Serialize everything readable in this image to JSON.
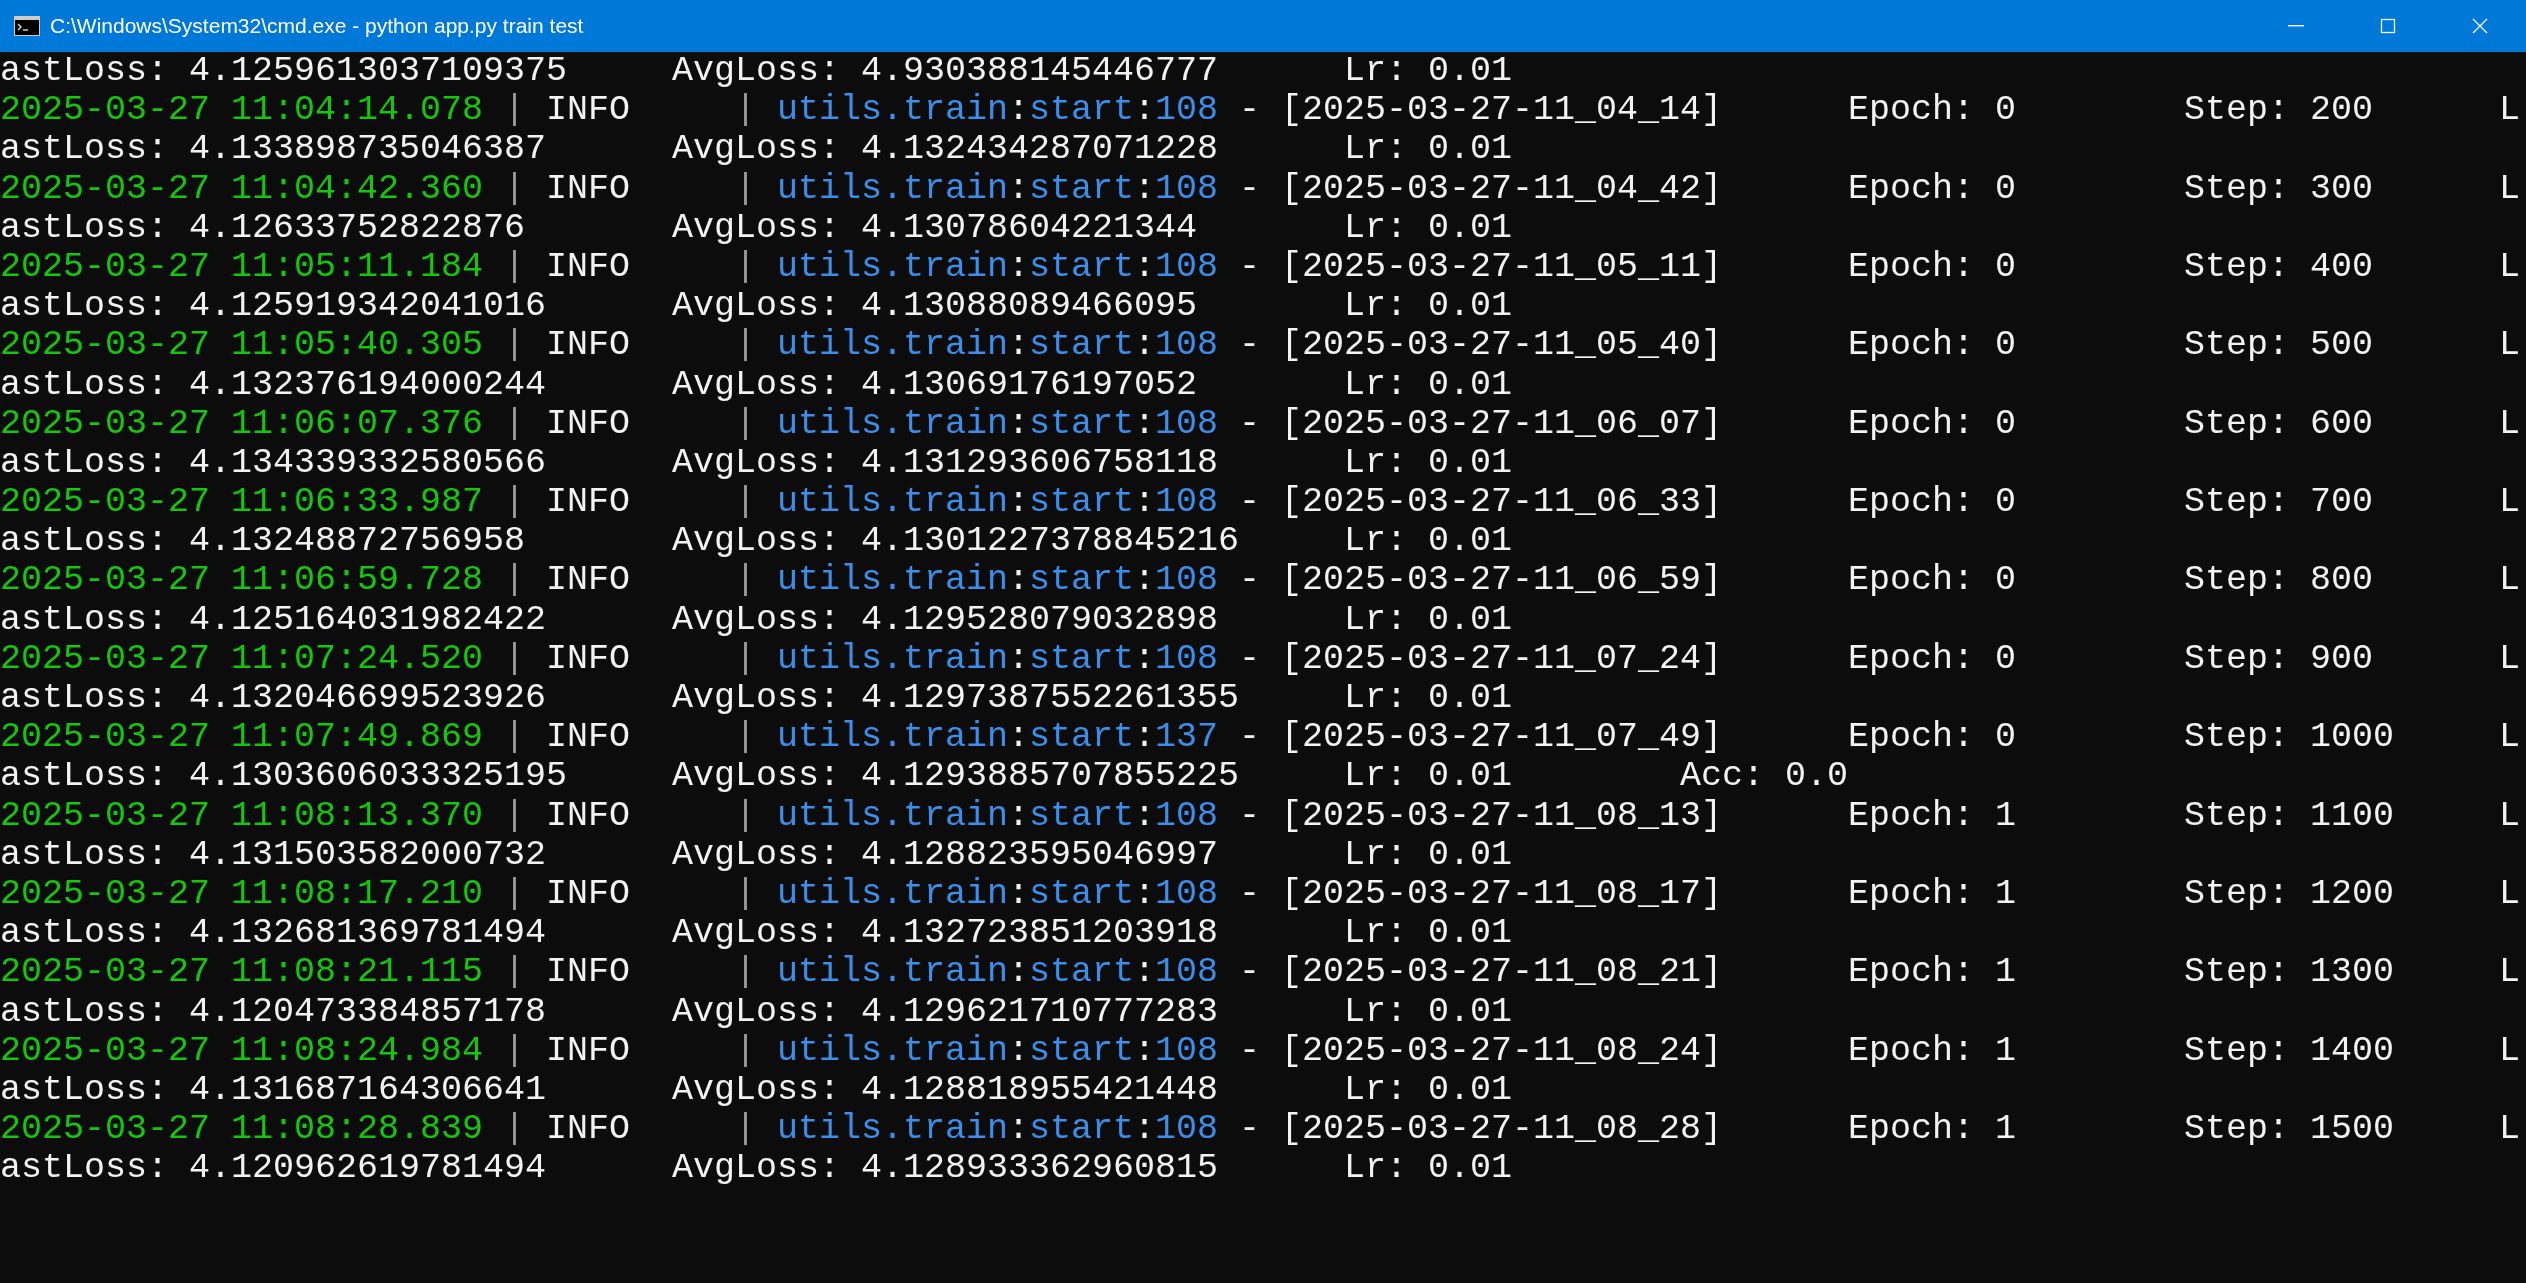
{
  "window": {
    "title": "C:\\Windows\\System32\\cmd.exe - python  app.py train test"
  },
  "lines": [
    {
      "kind": "loss",
      "segments": [
        {
          "kind": "value",
          "text": "astLoss: 4.1259613037109375"
        },
        {
          "kind": "value",
          "text": "AvgLoss: 4.930388145446777"
        },
        {
          "kind": "value",
          "text": "Lr: 0.01"
        }
      ]
    },
    {
      "kind": "log",
      "segments": [
        {
          "kind": "timestamp",
          "text": "2025-03-27 11:04:14.078"
        },
        {
          "kind": "bar",
          "text": "|"
        },
        {
          "kind": "level",
          "text": "INFO"
        },
        {
          "kind": "bar",
          "text": "|"
        },
        {
          "kind": "module",
          "text": "utils.train"
        },
        {
          "kind": "colon",
          "text": ":"
        },
        {
          "kind": "function",
          "text": "start"
        },
        {
          "kind": "colon",
          "text": ":"
        },
        {
          "kind": "lineno",
          "text": "108"
        },
        {
          "kind": "dash",
          "text": "-"
        },
        {
          "kind": "value",
          "text": "[2025-03-27-11_04_14]"
        },
        {
          "kind": "value",
          "text": "Epoch: 0"
        },
        {
          "kind": "value",
          "text": "Step: 200"
        },
        {
          "kind": "value",
          "text": "L"
        }
      ]
    },
    {
      "kind": "loss",
      "segments": [
        {
          "kind": "value",
          "text": "astLoss: 4.133898735046387"
        },
        {
          "kind": "value",
          "text": "AvgLoss: 4.132434287071228"
        },
        {
          "kind": "value",
          "text": "Lr: 0.01"
        }
      ]
    },
    {
      "kind": "log",
      "segments": [
        {
          "kind": "timestamp",
          "text": "2025-03-27 11:04:42.360"
        },
        {
          "kind": "bar",
          "text": "|"
        },
        {
          "kind": "level",
          "text": "INFO"
        },
        {
          "kind": "bar",
          "text": "|"
        },
        {
          "kind": "module",
          "text": "utils.train"
        },
        {
          "kind": "colon",
          "text": ":"
        },
        {
          "kind": "function",
          "text": "start"
        },
        {
          "kind": "colon",
          "text": ":"
        },
        {
          "kind": "lineno",
          "text": "108"
        },
        {
          "kind": "dash",
          "text": "-"
        },
        {
          "kind": "value",
          "text": "[2025-03-27-11_04_42]"
        },
        {
          "kind": "value",
          "text": "Epoch: 0"
        },
        {
          "kind": "value",
          "text": "Step: 300"
        },
        {
          "kind": "value",
          "text": "L"
        }
      ]
    },
    {
      "kind": "loss",
      "segments": [
        {
          "kind": "value",
          "text": "astLoss: 4.12633752822876"
        },
        {
          "kind": "value",
          "text": "AvgLoss: 4.13078604221344"
        },
        {
          "kind": "value",
          "text": "Lr: 0.01"
        }
      ]
    },
    {
      "kind": "log",
      "segments": [
        {
          "kind": "timestamp",
          "text": "2025-03-27 11:05:11.184"
        },
        {
          "kind": "bar",
          "text": "|"
        },
        {
          "kind": "level",
          "text": "INFO"
        },
        {
          "kind": "bar",
          "text": "|"
        },
        {
          "kind": "module",
          "text": "utils.train"
        },
        {
          "kind": "colon",
          "text": ":"
        },
        {
          "kind": "function",
          "text": "start"
        },
        {
          "kind": "colon",
          "text": ":"
        },
        {
          "kind": "lineno",
          "text": "108"
        },
        {
          "kind": "dash",
          "text": "-"
        },
        {
          "kind": "value",
          "text": "[2025-03-27-11_05_11]"
        },
        {
          "kind": "value",
          "text": "Epoch: 0"
        },
        {
          "kind": "value",
          "text": "Step: 400"
        },
        {
          "kind": "value",
          "text": "L"
        }
      ]
    },
    {
      "kind": "loss",
      "segments": [
        {
          "kind": "value",
          "text": "astLoss: 4.125919342041016"
        },
        {
          "kind": "value",
          "text": "AvgLoss: 4.13088089466095"
        },
        {
          "kind": "value",
          "text": "Lr: 0.01"
        }
      ]
    },
    {
      "kind": "log",
      "segments": [
        {
          "kind": "timestamp",
          "text": "2025-03-27 11:05:40.305"
        },
        {
          "kind": "bar",
          "text": "|"
        },
        {
          "kind": "level",
          "text": "INFO"
        },
        {
          "kind": "bar",
          "text": "|"
        },
        {
          "kind": "module",
          "text": "utils.train"
        },
        {
          "kind": "colon",
          "text": ":"
        },
        {
          "kind": "function",
          "text": "start"
        },
        {
          "kind": "colon",
          "text": ":"
        },
        {
          "kind": "lineno",
          "text": "108"
        },
        {
          "kind": "dash",
          "text": "-"
        },
        {
          "kind": "value",
          "text": "[2025-03-27-11_05_40]"
        },
        {
          "kind": "value",
          "text": "Epoch: 0"
        },
        {
          "kind": "value",
          "text": "Step: 500"
        },
        {
          "kind": "value",
          "text": "L"
        }
      ]
    },
    {
      "kind": "loss",
      "segments": [
        {
          "kind": "value",
          "text": "astLoss: 4.132376194000244"
        },
        {
          "kind": "value",
          "text": "AvgLoss: 4.13069176197052"
        },
        {
          "kind": "value",
          "text": "Lr: 0.01"
        }
      ]
    },
    {
      "kind": "log",
      "segments": [
        {
          "kind": "timestamp",
          "text": "2025-03-27 11:06:07.376"
        },
        {
          "kind": "bar",
          "text": "|"
        },
        {
          "kind": "level",
          "text": "INFO"
        },
        {
          "kind": "bar",
          "text": "|"
        },
        {
          "kind": "module",
          "text": "utils.train"
        },
        {
          "kind": "colon",
          "text": ":"
        },
        {
          "kind": "function",
          "text": "start"
        },
        {
          "kind": "colon",
          "text": ":"
        },
        {
          "kind": "lineno",
          "text": "108"
        },
        {
          "kind": "dash",
          "text": "-"
        },
        {
          "kind": "value",
          "text": "[2025-03-27-11_06_07]"
        },
        {
          "kind": "value",
          "text": "Epoch: 0"
        },
        {
          "kind": "value",
          "text": "Step: 600"
        },
        {
          "kind": "value",
          "text": "L"
        }
      ]
    },
    {
      "kind": "loss",
      "segments": [
        {
          "kind": "value",
          "text": "astLoss: 4.134339332580566"
        },
        {
          "kind": "value",
          "text": "AvgLoss: 4.131293606758118"
        },
        {
          "kind": "value",
          "text": "Lr: 0.01"
        }
      ]
    },
    {
      "kind": "log",
      "segments": [
        {
          "kind": "timestamp",
          "text": "2025-03-27 11:06:33.987"
        },
        {
          "kind": "bar",
          "text": "|"
        },
        {
          "kind": "level",
          "text": "INFO"
        },
        {
          "kind": "bar",
          "text": "|"
        },
        {
          "kind": "module",
          "text": "utils.train"
        },
        {
          "kind": "colon",
          "text": ":"
        },
        {
          "kind": "function",
          "text": "start"
        },
        {
          "kind": "colon",
          "text": ":"
        },
        {
          "kind": "lineno",
          "text": "108"
        },
        {
          "kind": "dash",
          "text": "-"
        },
        {
          "kind": "value",
          "text": "[2025-03-27-11_06_33]"
        },
        {
          "kind": "value",
          "text": "Epoch: 0"
        },
        {
          "kind": "value",
          "text": "Step: 700"
        },
        {
          "kind": "value",
          "text": "L"
        }
      ]
    },
    {
      "kind": "loss",
      "segments": [
        {
          "kind": "value",
          "text": "astLoss: 4.13248872756958"
        },
        {
          "kind": "value",
          "text": "AvgLoss: 4.1301227378845216"
        },
        {
          "kind": "value",
          "text": "Lr: 0.01"
        }
      ]
    },
    {
      "kind": "log",
      "segments": [
        {
          "kind": "timestamp",
          "text": "2025-03-27 11:06:59.728"
        },
        {
          "kind": "bar",
          "text": "|"
        },
        {
          "kind": "level",
          "text": "INFO"
        },
        {
          "kind": "bar",
          "text": "|"
        },
        {
          "kind": "module",
          "text": "utils.train"
        },
        {
          "kind": "colon",
          "text": ":"
        },
        {
          "kind": "function",
          "text": "start"
        },
        {
          "kind": "colon",
          "text": ":"
        },
        {
          "kind": "lineno",
          "text": "108"
        },
        {
          "kind": "dash",
          "text": "-"
        },
        {
          "kind": "value",
          "text": "[2025-03-27-11_06_59]"
        },
        {
          "kind": "value",
          "text": "Epoch: 0"
        },
        {
          "kind": "value",
          "text": "Step: 800"
        },
        {
          "kind": "value",
          "text": "L"
        }
      ]
    },
    {
      "kind": "loss",
      "segments": [
        {
          "kind": "value",
          "text": "astLoss: 4.125164031982422"
        },
        {
          "kind": "value",
          "text": "AvgLoss: 4.129528079032898"
        },
        {
          "kind": "value",
          "text": "Lr: 0.01"
        }
      ]
    },
    {
      "kind": "log",
      "segments": [
        {
          "kind": "timestamp",
          "text": "2025-03-27 11:07:24.520"
        },
        {
          "kind": "bar",
          "text": "|"
        },
        {
          "kind": "level",
          "text": "INFO"
        },
        {
          "kind": "bar",
          "text": "|"
        },
        {
          "kind": "module",
          "text": "utils.train"
        },
        {
          "kind": "colon",
          "text": ":"
        },
        {
          "kind": "function",
          "text": "start"
        },
        {
          "kind": "colon",
          "text": ":"
        },
        {
          "kind": "lineno",
          "text": "108"
        },
        {
          "kind": "dash",
          "text": "-"
        },
        {
          "kind": "value",
          "text": "[2025-03-27-11_07_24]"
        },
        {
          "kind": "value",
          "text": "Epoch: 0"
        },
        {
          "kind": "value",
          "text": "Step: 900"
        },
        {
          "kind": "value",
          "text": "L"
        }
      ]
    },
    {
      "kind": "loss",
      "segments": [
        {
          "kind": "value",
          "text": "astLoss: 4.132046699523926"
        },
        {
          "kind": "value",
          "text": "AvgLoss: 4.1297387552261355"
        },
        {
          "kind": "value",
          "text": "Lr: 0.01"
        }
      ]
    },
    {
      "kind": "log",
      "segments": [
        {
          "kind": "timestamp",
          "text": "2025-03-27 11:07:49.869"
        },
        {
          "kind": "bar",
          "text": "|"
        },
        {
          "kind": "level",
          "text": "INFO"
        },
        {
          "kind": "bar",
          "text": "|"
        },
        {
          "kind": "module",
          "text": "utils.train"
        },
        {
          "kind": "colon",
          "text": ":"
        },
        {
          "kind": "function",
          "text": "start"
        },
        {
          "kind": "colon",
          "text": ":"
        },
        {
          "kind": "lineno",
          "text": "137"
        },
        {
          "kind": "dash",
          "text": "-"
        },
        {
          "kind": "value",
          "text": "[2025-03-27-11_07_49]"
        },
        {
          "kind": "value",
          "text": "Epoch: 0"
        },
        {
          "kind": "value",
          "text": "Step: 1000"
        },
        {
          "kind": "value",
          "text": "L"
        }
      ]
    },
    {
      "kind": "loss",
      "segments": [
        {
          "kind": "value",
          "text": "astLoss: 4.1303606033325195"
        },
        {
          "kind": "value",
          "text": "AvgLoss: 4.1293885707855225"
        },
        {
          "kind": "value",
          "text": "Lr: 0.01"
        },
        {
          "kind": "value",
          "text": "Acc: 0.0"
        }
      ]
    },
    {
      "kind": "log",
      "segments": [
        {
          "kind": "timestamp",
          "text": "2025-03-27 11:08:13.370"
        },
        {
          "kind": "bar",
          "text": "|"
        },
        {
          "kind": "level",
          "text": "INFO"
        },
        {
          "kind": "bar",
          "text": "|"
        },
        {
          "kind": "module",
          "text": "utils.train"
        },
        {
          "kind": "colon",
          "text": ":"
        },
        {
          "kind": "function",
          "text": "start"
        },
        {
          "kind": "colon",
          "text": ":"
        },
        {
          "kind": "lineno",
          "text": "108"
        },
        {
          "kind": "dash",
          "text": "-"
        },
        {
          "kind": "value",
          "text": "[2025-03-27-11_08_13]"
        },
        {
          "kind": "value",
          "text": "Epoch: 1"
        },
        {
          "kind": "value",
          "text": "Step: 1100"
        },
        {
          "kind": "value",
          "text": "L"
        }
      ]
    },
    {
      "kind": "loss",
      "segments": [
        {
          "kind": "value",
          "text": "astLoss: 4.131503582000732"
        },
        {
          "kind": "value",
          "text": "AvgLoss: 4.128823595046997"
        },
        {
          "kind": "value",
          "text": "Lr: 0.01"
        }
      ]
    },
    {
      "kind": "log",
      "segments": [
        {
          "kind": "timestamp",
          "text": "2025-03-27 11:08:17.210"
        },
        {
          "kind": "bar",
          "text": "|"
        },
        {
          "kind": "level",
          "text": "INFO"
        },
        {
          "kind": "bar",
          "text": "|"
        },
        {
          "kind": "module",
          "text": "utils.train"
        },
        {
          "kind": "colon",
          "text": ":"
        },
        {
          "kind": "function",
          "text": "start"
        },
        {
          "kind": "colon",
          "text": ":"
        },
        {
          "kind": "lineno",
          "text": "108"
        },
        {
          "kind": "dash",
          "text": "-"
        },
        {
          "kind": "value",
          "text": "[2025-03-27-11_08_17]"
        },
        {
          "kind": "value",
          "text": "Epoch: 1"
        },
        {
          "kind": "value",
          "text": "Step: 1200"
        },
        {
          "kind": "value",
          "text": "L"
        }
      ]
    },
    {
      "kind": "loss",
      "segments": [
        {
          "kind": "value",
          "text": "astLoss: 4.132681369781494"
        },
        {
          "kind": "value",
          "text": "AvgLoss: 4.132723851203918"
        },
        {
          "kind": "value",
          "text": "Lr: 0.01"
        }
      ]
    },
    {
      "kind": "log",
      "segments": [
        {
          "kind": "timestamp",
          "text": "2025-03-27 11:08:21.115"
        },
        {
          "kind": "bar",
          "text": "|"
        },
        {
          "kind": "level",
          "text": "INFO"
        },
        {
          "kind": "bar",
          "text": "|"
        },
        {
          "kind": "module",
          "text": "utils.train"
        },
        {
          "kind": "colon",
          "text": ":"
        },
        {
          "kind": "function",
          "text": "start"
        },
        {
          "kind": "colon",
          "text": ":"
        },
        {
          "kind": "lineno",
          "text": "108"
        },
        {
          "kind": "dash",
          "text": "-"
        },
        {
          "kind": "value",
          "text": "[2025-03-27-11_08_21]"
        },
        {
          "kind": "value",
          "text": "Epoch: 1"
        },
        {
          "kind": "value",
          "text": "Step: 1300"
        },
        {
          "kind": "value",
          "text": "L"
        }
      ]
    },
    {
      "kind": "loss",
      "segments": [
        {
          "kind": "value",
          "text": "astLoss: 4.120473384857178"
        },
        {
          "kind": "value",
          "text": "AvgLoss: 4.129621710777283"
        },
        {
          "kind": "value",
          "text": "Lr: 0.01"
        }
      ]
    },
    {
      "kind": "log",
      "segments": [
        {
          "kind": "timestamp",
          "text": "2025-03-27 11:08:24.984"
        },
        {
          "kind": "bar",
          "text": "|"
        },
        {
          "kind": "level",
          "text": "INFO"
        },
        {
          "kind": "bar",
          "text": "|"
        },
        {
          "kind": "module",
          "text": "utils.train"
        },
        {
          "kind": "colon",
          "text": ":"
        },
        {
          "kind": "function",
          "text": "start"
        },
        {
          "kind": "colon",
          "text": ":"
        },
        {
          "kind": "lineno",
          "text": "108"
        },
        {
          "kind": "dash",
          "text": "-"
        },
        {
          "kind": "value",
          "text": "[2025-03-27-11_08_24]"
        },
        {
          "kind": "value",
          "text": "Epoch: 1"
        },
        {
          "kind": "value",
          "text": "Step: 1400"
        },
        {
          "kind": "value",
          "text": "L"
        }
      ]
    },
    {
      "kind": "loss",
      "segments": [
        {
          "kind": "value",
          "text": "astLoss: 4.131687164306641"
        },
        {
          "kind": "value",
          "text": "AvgLoss: 4.128818955421448"
        },
        {
          "kind": "value",
          "text": "Lr: 0.01"
        }
      ]
    },
    {
      "kind": "log",
      "segments": [
        {
          "kind": "timestamp",
          "text": "2025-03-27 11:08:28.839"
        },
        {
          "kind": "bar",
          "text": "|"
        },
        {
          "kind": "level",
          "text": "INFO"
        },
        {
          "kind": "bar",
          "text": "|"
        },
        {
          "kind": "module",
          "text": "utils.train"
        },
        {
          "kind": "colon",
          "text": ":"
        },
        {
          "kind": "function",
          "text": "start"
        },
        {
          "kind": "colon",
          "text": ":"
        },
        {
          "kind": "lineno",
          "text": "108"
        },
        {
          "kind": "dash",
          "text": "-"
        },
        {
          "kind": "value",
          "text": "[2025-03-27-11_08_28]"
        },
        {
          "kind": "value",
          "text": "Epoch: 1"
        },
        {
          "kind": "value",
          "text": "Step: 1500"
        },
        {
          "kind": "value",
          "text": "L"
        }
      ]
    },
    {
      "kind": "loss",
      "segments": [
        {
          "kind": "value",
          "text": "astLoss: 4.120962619781494"
        },
        {
          "kind": "value",
          "text": "AvgLoss: 4.128933362960815"
        },
        {
          "kind": "value",
          "text": "Lr: 0.01"
        }
      ]
    }
  ]
}
